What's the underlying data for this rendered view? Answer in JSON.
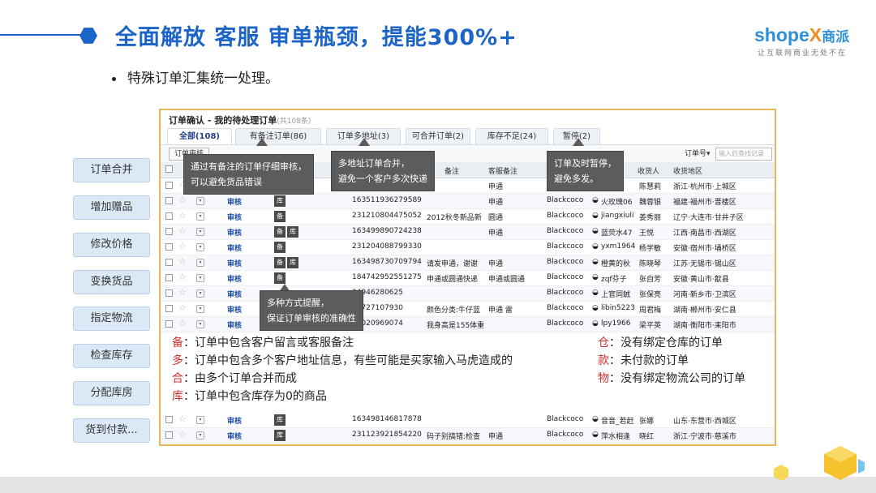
{
  "header": {
    "title": "全面解放 客服 审单瓶颈，提能300%+",
    "logo": "shopeX商派",
    "tagline": "让互联网商业无处不在",
    "bullet": "特殊订单汇集统一处理。"
  },
  "sidebar": [
    "订单合并",
    "增加赠品",
    "修改价格",
    "变换货品",
    "指定物流",
    "检查库存",
    "分配库房",
    "货到付款..."
  ],
  "screenshot": {
    "title": "订单确认 - 我的待处理订单",
    "count": "(共108条)",
    "tabs": [
      "全部(108)",
      "有备注订单(86)",
      "订单多地址(3)",
      "可合并订单(2)",
      "库存不足(24)",
      "暂停(2)"
    ],
    "toolbar_button": "订单审核",
    "search_type": "订单号▾",
    "search_placeholder": "输入后查找记录",
    "columns": [
      "备注",
      "客服备注",
      "收货人",
      "收货地区"
    ],
    "rows": [
      {
        "audit": "审核",
        "badges": [],
        "order": "",
        "remark": "",
        "cs": "申通",
        "shop": "",
        "buyer": "尾",
        "name": "陈慧莉",
        "region": "浙江·杭州市·上城区"
      },
      {
        "audit": "审核",
        "badges": [
          "库"
        ],
        "order": "163511936279589",
        "remark": "",
        "cs": "申通",
        "shop": "Blackcoco",
        "buyer": "火玫瑰06",
        "name": "魏蓉银",
        "region": "福建·福州市·晋楼区"
      },
      {
        "audit": "审核",
        "badges": [
          "备"
        ],
        "order": "231210804475052",
        "remark": "2012秋冬新品新",
        "cs": "圆通",
        "shop": "Blackcoco",
        "buyer": "jiangxiuli",
        "name": "姜秀丽",
        "region": "辽宁·大连市·甘井子区"
      },
      {
        "audit": "审核",
        "badges": [
          "备",
          "库"
        ],
        "order": "163499890724238",
        "remark": "",
        "cs": "申通",
        "shop": "Blackcoco",
        "buyer": "蓝荧水47",
        "name": "王悦",
        "region": "江西·南昌市·西湖区"
      },
      {
        "audit": "审核",
        "badges": [
          "备"
        ],
        "order": "231204088799330",
        "remark": "",
        "cs": "",
        "shop": "Blackcoco",
        "buyer": "yxm1964",
        "name": "杨学敏",
        "region": "安徽·宿州市·埇桥区"
      },
      {
        "audit": "审核",
        "badges": [
          "备",
          "库"
        ],
        "order": "163498730709794",
        "remark": "请发申通，谢谢",
        "cs": "申通",
        "shop": "Blackcoco",
        "buyer": "橙黄的秋",
        "name": "陈晓琴",
        "region": "江苏·无锡市·锡山区"
      },
      {
        "audit": "审核",
        "badges": [
          "备"
        ],
        "order": "184742952551275",
        "remark": "申通或圆通快递",
        "cs": "申通或圆通",
        "shop": "Blackcoco",
        "buyer": "zqf芬子",
        "name": "张自芳",
        "region": "安徽·黄山市·歙县"
      },
      {
        "audit": "审核",
        "badges": [],
        "order": "34946280625",
        "remark": "",
        "cs": "",
        "shop": "Blackcoco",
        "buyer": "上官同銊",
        "name": "张保亮",
        "region": "河南·新乡市·卫滨区"
      },
      {
        "audit": "审核",
        "badges": [],
        "order": "34727107930",
        "remark": "颜色分类:牛仔蓝",
        "cs": "申通 雷",
        "shop": "Blackcoco",
        "buyer": "libin5223",
        "name": "周君梅",
        "region": "湖南·郴州市·安仁县"
      },
      {
        "audit": "审核",
        "badges": [],
        "order": "13020969074",
        "remark": "我身高是155体重",
        "cs": "",
        "shop": "Blackcoco",
        "buyer": "lpy1966",
        "name": "梁平英",
        "region": "湖南·衡阳市·耒阳市"
      }
    ],
    "bottom_rows": [
      {
        "audit": "审核",
        "badges": [
          "库"
        ],
        "order": "163498146817878",
        "remark": "",
        "cs": "",
        "shop": "Blackcoco",
        "buyer": "音音_若赶",
        "name": "张娜",
        "region": "山东·东营市·西城区"
      },
      {
        "audit": "审核",
        "badges": [
          "库"
        ],
        "order": "231123921854220",
        "remark": "码子别搞错:检查",
        "cs": "申通",
        "shop": "Blackcoco",
        "buyer": "萍水相逢",
        "name": "晓红",
        "region": "浙江·宁波市·慈溪市"
      }
    ]
  },
  "tooltips": [
    "通过有备注的订单仔细审核，\n可以避免货品错误",
    "多地址订单合并，\n避免一个客户多次快递",
    "订单及时暂停，\n避免多发。",
    "多种方式提醒，\n保证订单审核的准确性"
  ],
  "legend": {
    "left": [
      {
        "key": "备",
        "text": "：订单中包含客户留言或客服备注"
      },
      {
        "key": "多",
        "text": "：订单中包含多个客户地址信息，有些可能是买家输入马虎造成的"
      },
      {
        "key": "合",
        "text": "：由多个订单合并而成"
      },
      {
        "key": "库",
        "text": "：订单中包含库存为0的商品"
      }
    ],
    "right": [
      {
        "key": "仓",
        "text": "：没有绑定仓库的订单"
      },
      {
        "key": "款",
        "text": "：未付款的订单"
      },
      {
        "key": "物",
        "text": "：没有绑定物流公司的订单"
      }
    ]
  },
  "colors": {
    "accent": "#1c64c8",
    "frame": "#e3b85a",
    "legend_key": "#d23030",
    "tooltip": "#5c5c5c"
  }
}
